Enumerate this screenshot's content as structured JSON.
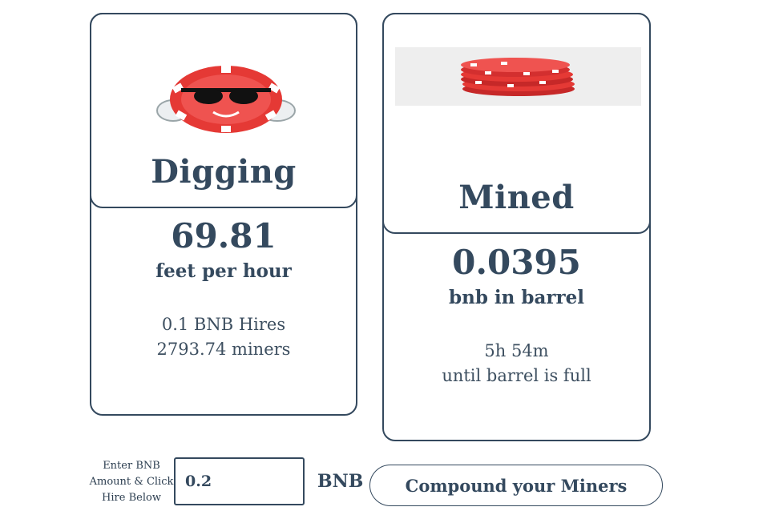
{
  "digging": {
    "title": "Digging",
    "value": "69.81",
    "unit": "feet per hour",
    "note": "0.1 BNB Hires 2793.74 miners",
    "image_icon": "chip-with-sunglasses-icon"
  },
  "mined": {
    "title": "Mined",
    "value": "0.0395",
    "unit": "bnb in barrel",
    "time": "5h 54m",
    "note": "until barrel is full",
    "image_icon": "chip-stack-icon"
  },
  "hire": {
    "hint": "Enter BNB Amount & Click Hire Below",
    "amount_value": "0.2",
    "currency": "BNB"
  },
  "compound_label": "Compound your Miners",
  "colors": {
    "accent": "#34495e",
    "chip_red": "#e53935"
  }
}
